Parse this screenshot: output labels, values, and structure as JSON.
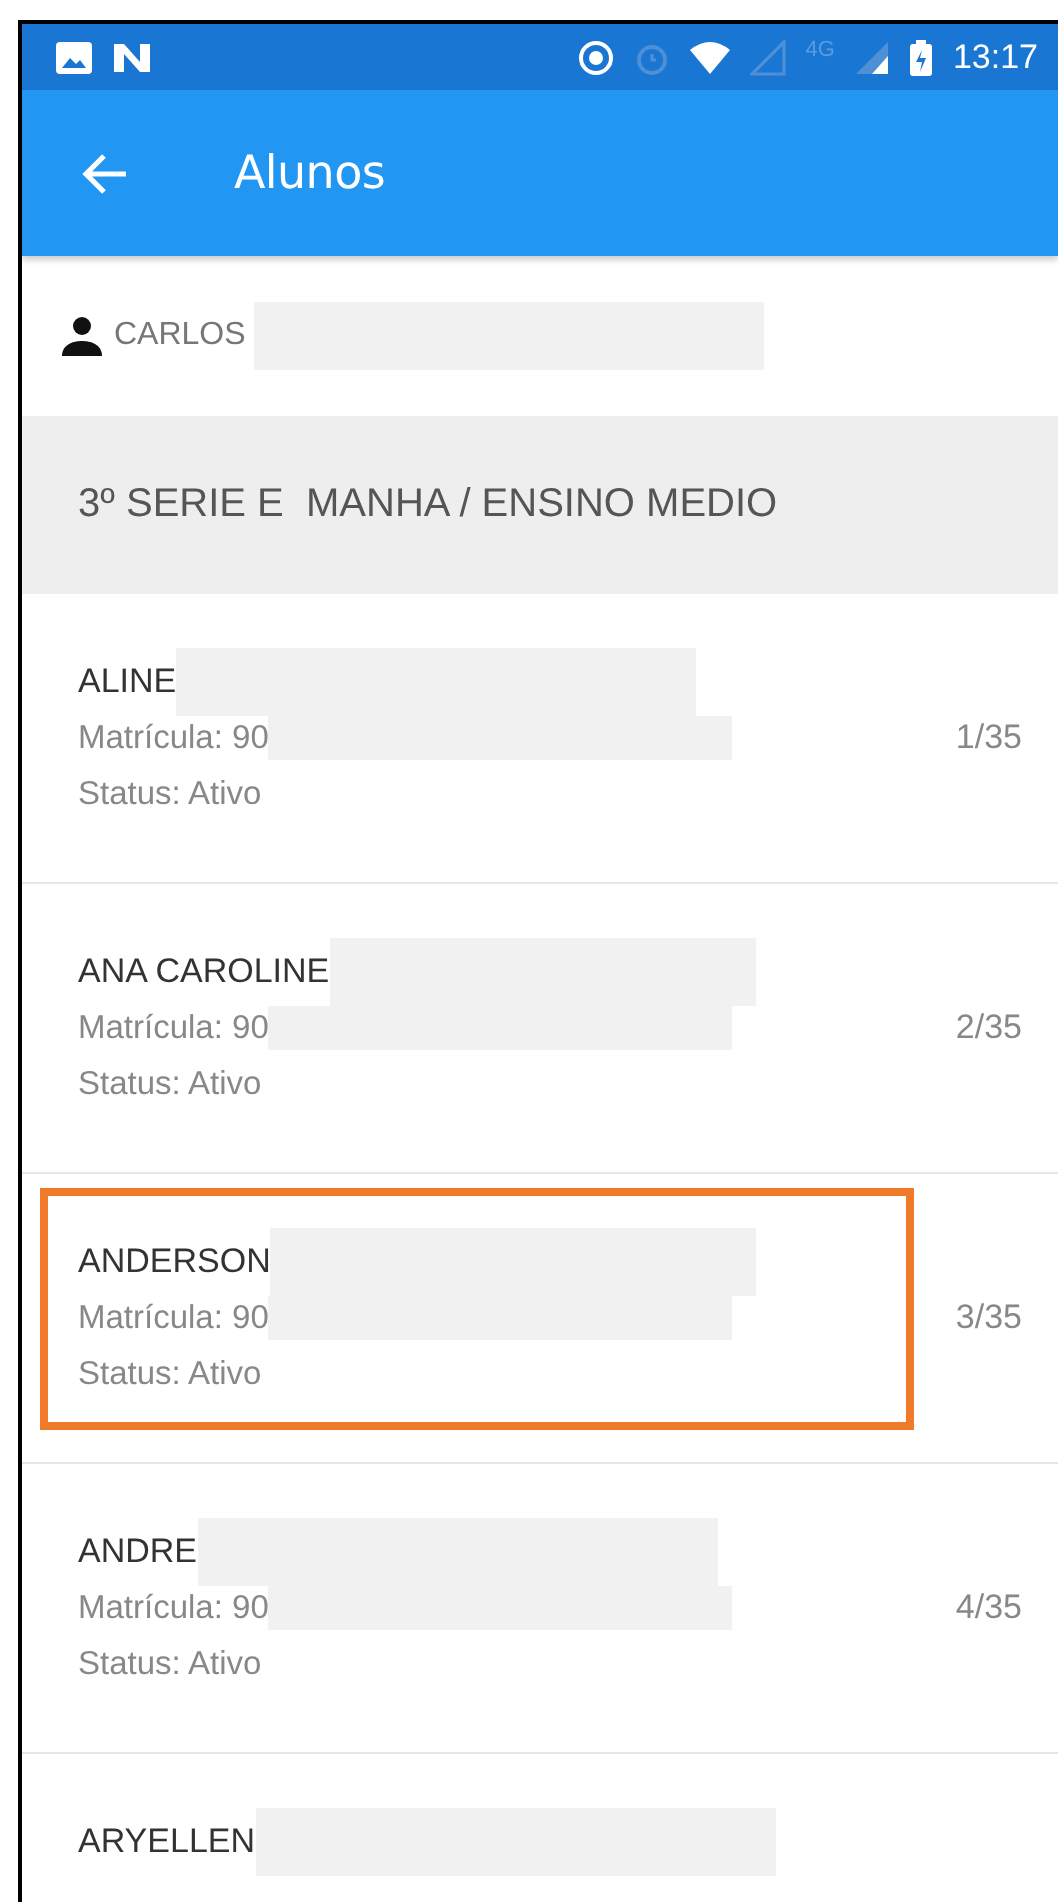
{
  "status_bar": {
    "network_label": "4G",
    "time": "13:17"
  },
  "app_bar": {
    "title": "Alunos"
  },
  "user": {
    "name": "CARLOS"
  },
  "section": {
    "title": "3º SERIE E  MANHA / ENSINO MEDIO"
  },
  "students": [
    {
      "name": "ALINE",
      "registration": "Matrícula: 90",
      "status": "Status: Ativo",
      "position": "1/35",
      "highlighted": false
    },
    {
      "name": "ANA CAROLINE",
      "registration": "Matrícula: 90",
      "status": "Status: Ativo",
      "position": "2/35",
      "highlighted": false
    },
    {
      "name": "ANDERSON",
      "registration": "Matrícula: 90",
      "status": "Status: Ativo",
      "position": "3/35",
      "highlighted": true
    },
    {
      "name": "ANDRE",
      "registration": "Matrícula: 90",
      "status": "Status: Ativo",
      "position": "4/35",
      "highlighted": false
    },
    {
      "name": "ARYELLEN",
      "highlighted": false
    }
  ]
}
